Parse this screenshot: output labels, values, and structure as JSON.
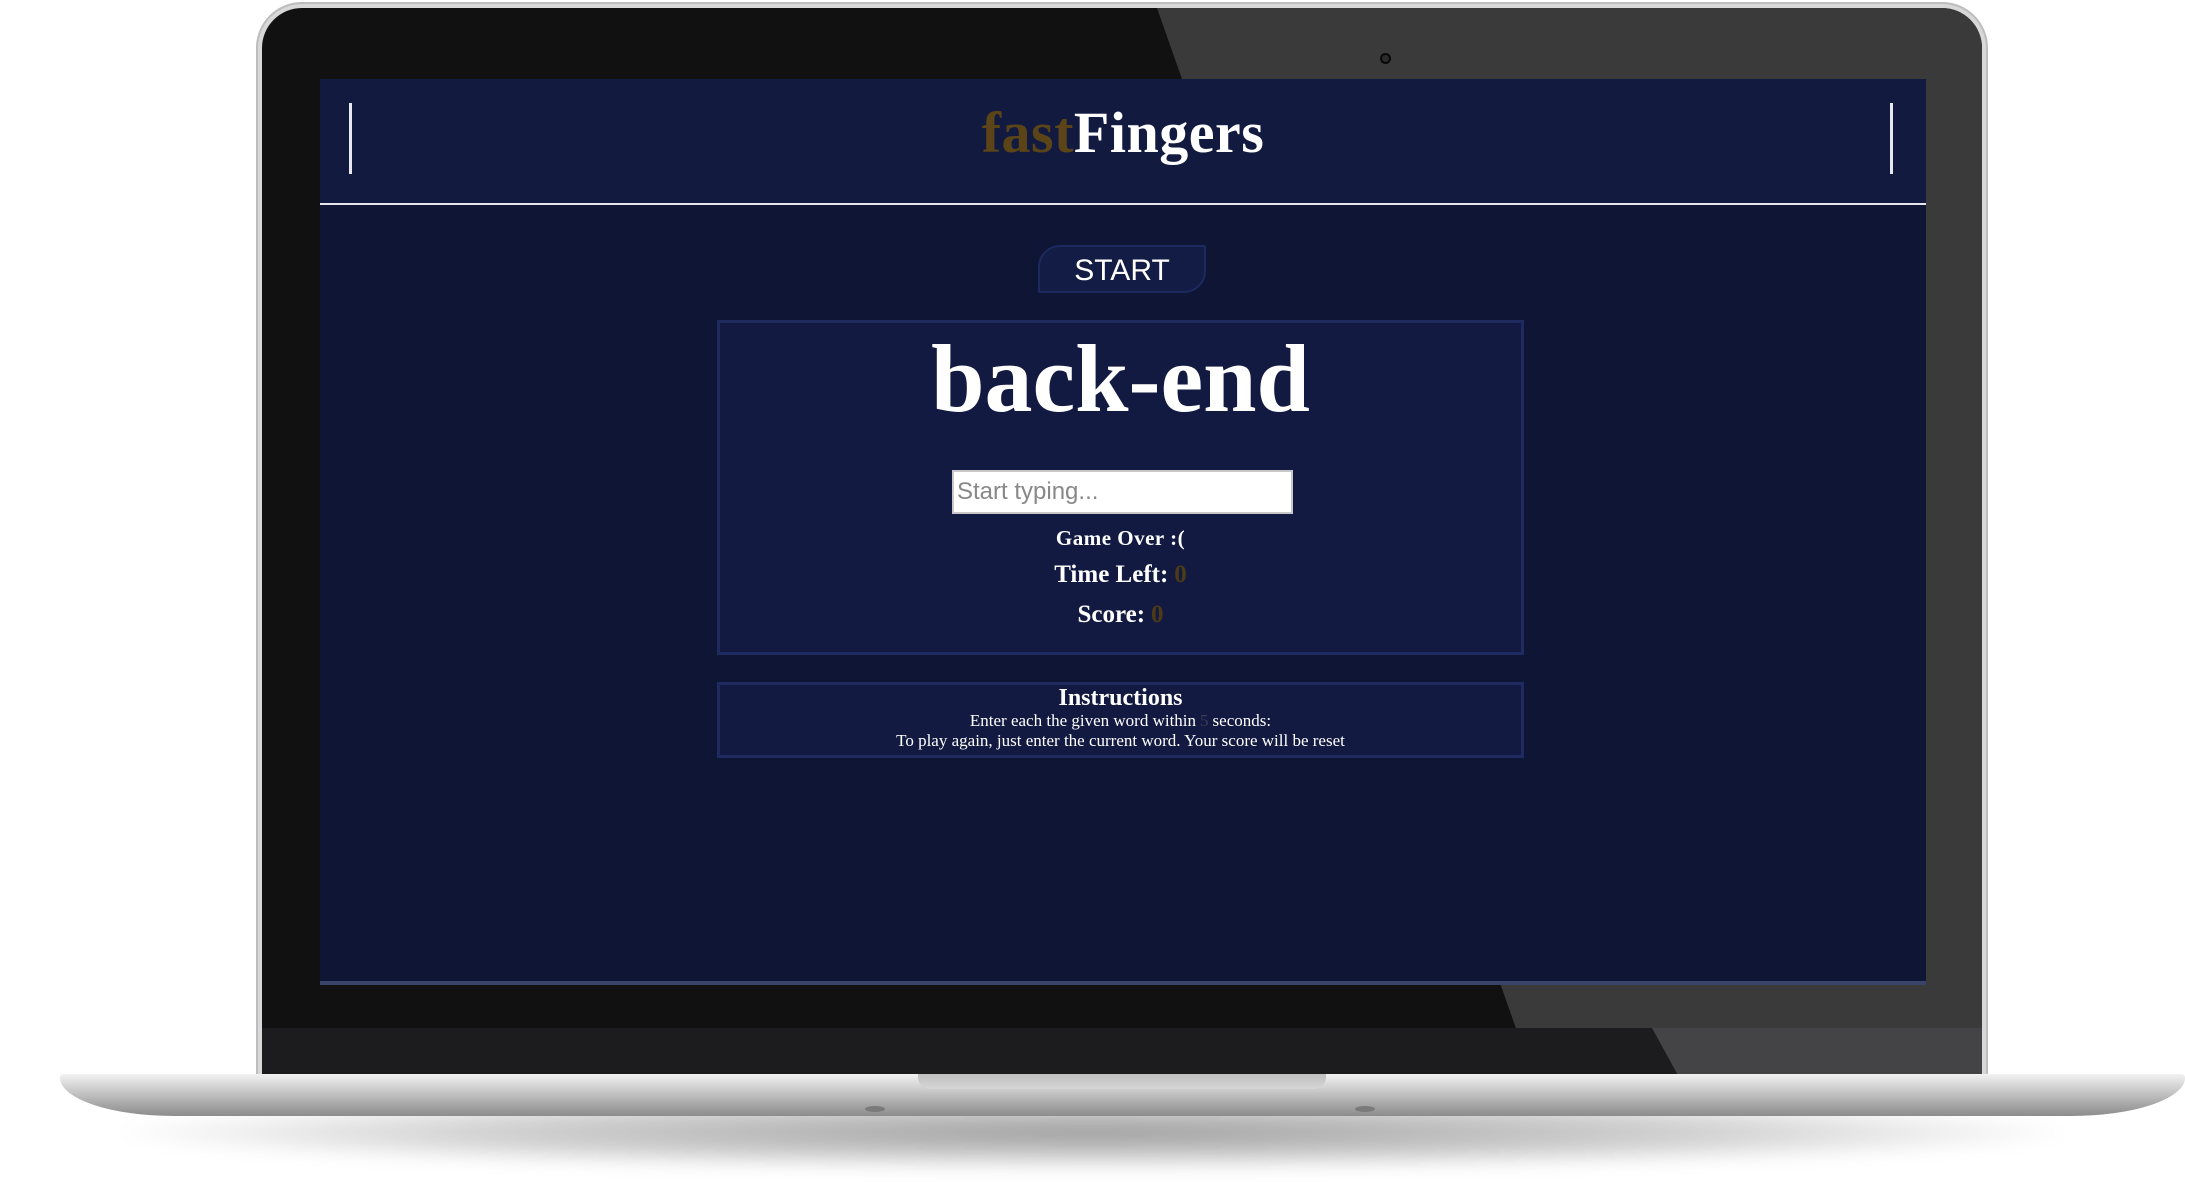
{
  "app": {
    "brand_part1": "fast",
    "brand_part2": "Fingers"
  },
  "controls": {
    "start_label": "START"
  },
  "game": {
    "current_word": "back-end",
    "input_placeholder": "Start typing...",
    "input_value": "",
    "message": "Game Over :(",
    "time_left_label": "Time Left:",
    "time_left_value": "0",
    "score_label": "Score:",
    "score_value": "0"
  },
  "instructions": {
    "title": "Instructions",
    "line1_prefix": "Enter each the given word within",
    "seconds_value": "5",
    "line1_suffix": "seconds:",
    "line2": "To play again, just enter the current word. Your score will be reset"
  },
  "colors": {
    "background": "#0e1535",
    "header": "#121a40",
    "brand_accent": "#5a4418",
    "value_accent": "#4d3a16"
  }
}
